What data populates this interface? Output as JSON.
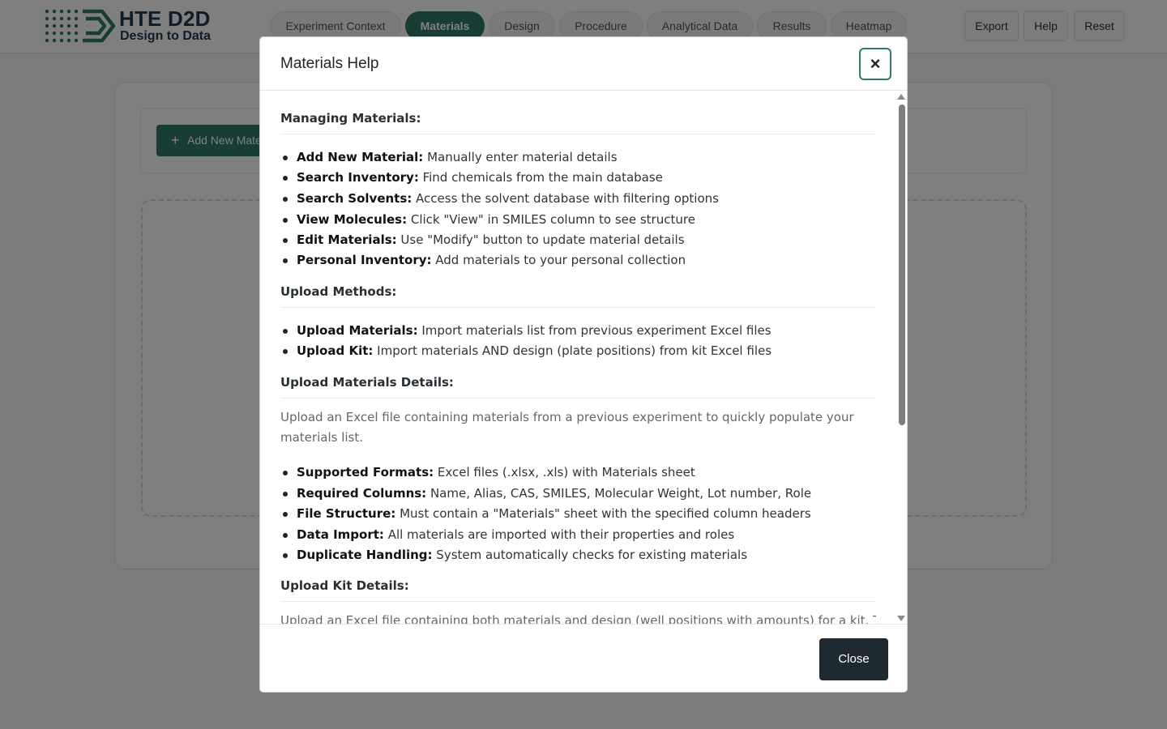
{
  "app": {
    "logo_title": "HTE D2D",
    "logo_subtitle": "Design to Data",
    "tabs": [
      {
        "label": "Experiment Context"
      },
      {
        "label": "Materials"
      },
      {
        "label": "Design"
      },
      {
        "label": "Procedure"
      },
      {
        "label": "Analytical Data"
      },
      {
        "label": "Results"
      },
      {
        "label": "Heatmap"
      }
    ],
    "active_tab": "Materials",
    "actions": {
      "export": "Export",
      "help": "Help",
      "reset": "Reset"
    }
  },
  "page": {
    "add_button_label": "Add New Material"
  },
  "modal": {
    "title": "Materials Help",
    "close_x": "×",
    "close_label": "Close",
    "managing": {
      "heading": "Managing Materials:",
      "items": [
        {
          "term": "Add New Material:",
          "desc": " Manually enter material details"
        },
        {
          "term": "Search Inventory:",
          "desc": " Find chemicals from the main database"
        },
        {
          "term": "Search Solvents:",
          "desc": " Access the solvent database with filtering options"
        },
        {
          "term": "View Molecules:",
          "desc": " Click \"View\" in SMILES column to see structure"
        },
        {
          "term": "Edit Materials:",
          "desc": " Use \"Modify\" button to update material details"
        },
        {
          "term": "Personal Inventory:",
          "desc": " Add materials to your personal collection"
        }
      ]
    },
    "upload_methods": {
      "heading": "Upload Methods:",
      "items": [
        {
          "term": "Upload Materials:",
          "desc": " Import materials list from previous experiment Excel files"
        },
        {
          "term": "Upload Kit:",
          "desc": " Import materials AND design (plate positions) from kit Excel files"
        }
      ]
    },
    "upload_materials_details": {
      "heading": "Upload Materials Details:",
      "paragraph": "Upload an Excel file containing materials from a previous experiment to quickly populate your materials list.",
      "items": [
        {
          "term": "Supported Formats:",
          "desc": " Excel files (.xlsx, .xls) with Materials sheet"
        },
        {
          "term": "Required Columns:",
          "desc": " Name, Alias, CAS, SMILES, Molecular Weight, Lot number, Role"
        },
        {
          "term": "File Structure:",
          "desc": " Must contain a \"Materials\" sheet with the specified column headers"
        },
        {
          "term": "Data Import:",
          "desc": " All materials are imported with their properties and roles"
        },
        {
          "term": "Duplicate Handling:",
          "desc": " System automatically checks for existing materials"
        }
      ]
    },
    "upload_kit_details": {
      "heading": "Upload Kit Details:",
      "paragraph": "Upload an Excel file containing both materials and design (well positions with amounts) for a kit. The kit"
    }
  },
  "colors": {
    "accent": "#2f7a6a",
    "brand_dark": "#1c3b4e",
    "footer_button": "#1e2a30"
  }
}
